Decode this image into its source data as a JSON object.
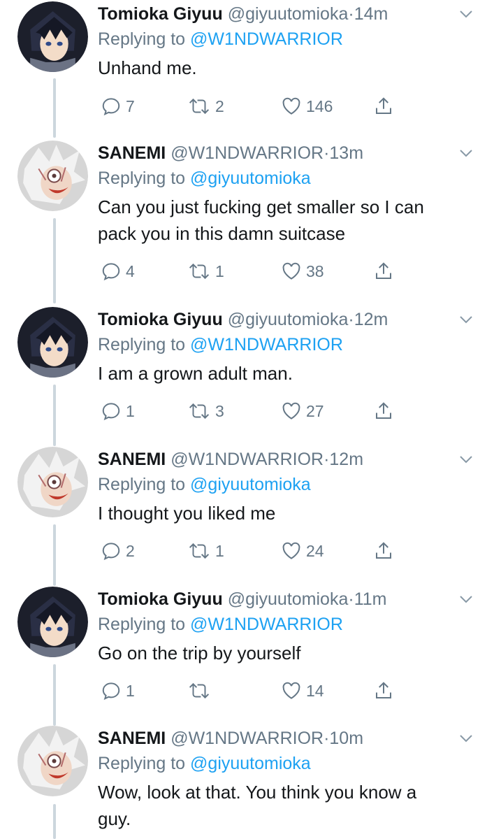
{
  "tweets": [
    {
      "name": "Tomioka Giyuu",
      "handle": "@giyuutomioka",
      "time": "14m",
      "replying_label": "Replying to",
      "replying_to": "@W1NDWARRIOR",
      "lines": [
        "Unhand me."
      ],
      "replies": "7",
      "retweets": "2",
      "likes": "146",
      "avatar": "giyuu"
    },
    {
      "name": "SANEMI",
      "handle": "@W1NDWARRIOR",
      "time": "13m",
      "replying_label": "Replying to",
      "replying_to": "@giyuutomioka",
      "lines": [
        "Can you just fucking get smaller so I can",
        "pack you in this damn suitcase"
      ],
      "replies": "4",
      "retweets": "1",
      "likes": "38",
      "avatar": "sanemi"
    },
    {
      "name": "Tomioka Giyuu",
      "handle": "@giyuutomioka",
      "time": "12m",
      "replying_label": "Replying to",
      "replying_to": "@W1NDWARRIOR",
      "lines": [
        "I am a grown adult man."
      ],
      "replies": "1",
      "retweets": "3",
      "likes": "27",
      "avatar": "giyuu"
    },
    {
      "name": "SANEMI",
      "handle": "@W1NDWARRIOR",
      "time": "12m",
      "replying_label": "Replying to",
      "replying_to": "@giyuutomioka",
      "lines": [
        "I thought you liked me"
      ],
      "replies": "2",
      "retweets": "1",
      "likes": "24",
      "avatar": "sanemi"
    },
    {
      "name": "Tomioka Giyuu",
      "handle": "@giyuutomioka",
      "time": "11m",
      "replying_label": "Replying to",
      "replying_to": "@W1NDWARRIOR",
      "lines": [
        "Go on the trip by yourself"
      ],
      "replies": "1",
      "retweets": "",
      "likes": "14",
      "avatar": "giyuu"
    },
    {
      "name": "SANEMI",
      "handle": "@W1NDWARRIOR",
      "time": "10m",
      "replying_label": "Replying to",
      "replying_to": "@giyuutomioka",
      "lines": [
        "Wow, look at that. You think you know a",
        "guy."
      ],
      "replies": null,
      "retweets": null,
      "likes": null,
      "avatar": "sanemi"
    }
  ],
  "colors": {
    "link": "#1da1f2",
    "muted": "#657786",
    "text": "#14171a",
    "thread_line": "#ccd6dd"
  },
  "icons": {
    "reply": "reply-icon",
    "retweet": "retweet-icon",
    "like": "heart-icon",
    "share": "share-icon",
    "caret": "chevron-down-icon"
  }
}
